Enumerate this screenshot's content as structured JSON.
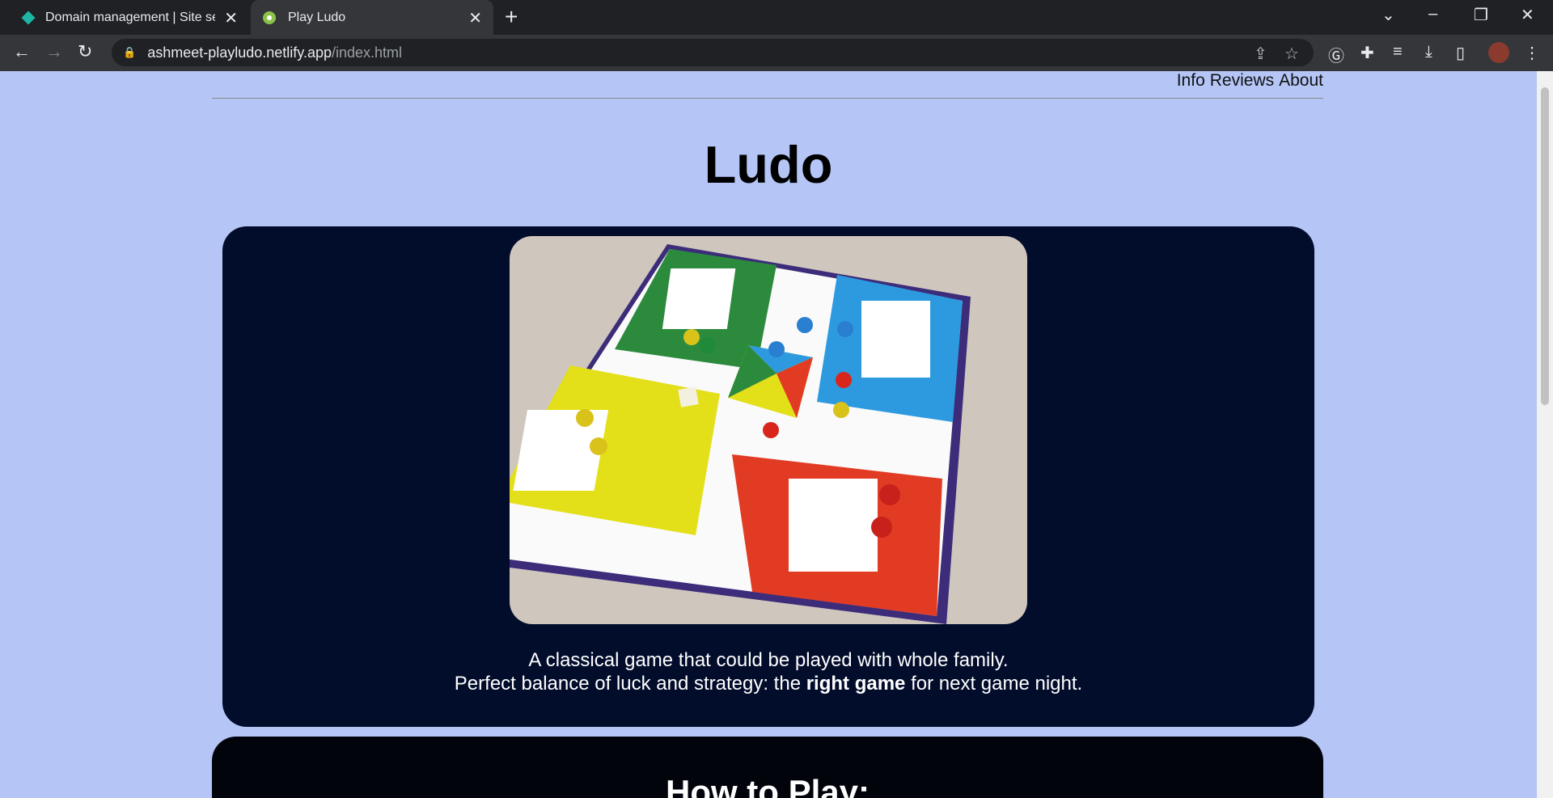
{
  "browser": {
    "tabs": [
      {
        "title": "Domain management | Site settin",
        "active": false
      },
      {
        "title": "Play Ludo",
        "active": true
      }
    ],
    "url_domain": "ashmeet-playludo.netlify.app",
    "url_path": "/index.html"
  },
  "page": {
    "nav": [
      "Info",
      "Reviews",
      "About"
    ],
    "title": "Ludo",
    "caption_line1": "A classical game that could be played with whole family.",
    "caption_line2_pre": "Perfect balance of luck and strategy: the ",
    "caption_line2_bold": "right game",
    "caption_line2_post": " for next game night.",
    "section2_title": "How to Play:"
  },
  "colors": {
    "page_bg": "#b4c5f6",
    "card_bg": "#020c2b"
  }
}
